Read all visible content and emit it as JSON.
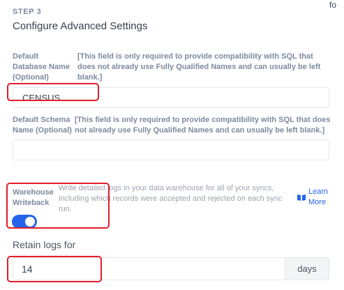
{
  "header": {
    "cutoff_text": "fo",
    "step_label": "STEP 3",
    "title": "Configure Advanced Settings"
  },
  "database_name": {
    "label": "Default Database Name (Optional)",
    "help": "[This field is only required to provide compatibility with SQL that does not already use Fully Qualified Names and can usually be left blank.]",
    "value": "CENSUS",
    "placeholder": ""
  },
  "schema_name": {
    "label": "Default Schema Name (Optional)",
    "help": "[This field is only required to provide compatibility with SQL that does not already use Fully Qualified Names and can usually be left blank.]",
    "value": "",
    "placeholder": ""
  },
  "warehouse_writeback": {
    "label": "Warehouse Writeback",
    "help": "Write detailed logs in your data warehouse for all of your syncs, including which records were accepted and rejected on each sync run.",
    "enabled": true,
    "learn_more": "Learn More"
  },
  "retain_logs": {
    "label": "Retain logs for",
    "value": "14",
    "unit": "days"
  },
  "colors": {
    "accent": "#2563eb",
    "highlight": "#e11d2a",
    "label": "#7c8a9c"
  }
}
